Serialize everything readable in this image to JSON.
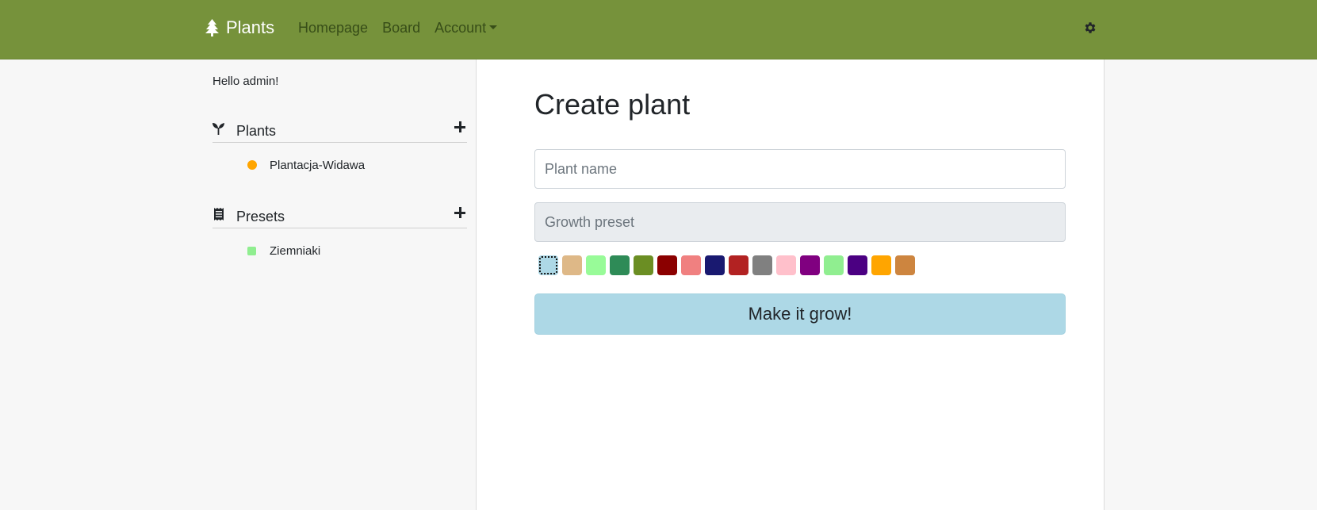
{
  "navbar": {
    "brand": "Plants",
    "links": [
      "Homepage",
      "Board",
      "Account"
    ],
    "settings_icon": "gear-icon"
  },
  "sidebar": {
    "greeting": "Hello admin!",
    "plants": {
      "title": "Plants",
      "icon": "seedling-icon",
      "items": [
        {
          "label": "Plantacja-Widawa",
          "color": "#ffa500"
        }
      ]
    },
    "presets": {
      "title": "Presets",
      "icon": "receipt-icon",
      "items": [
        {
          "label": "Ziemniaki",
          "color": "#90ee90"
        }
      ]
    }
  },
  "form": {
    "title": "Create plant",
    "name_placeholder": "Plant name",
    "preset_placeholder": "Growth preset",
    "selected_color": "#add8e6",
    "colors": [
      "#add8e6",
      "#deb887",
      "#98fb98",
      "#2e8b57",
      "#6b8e23",
      "#8b0000",
      "#f08080",
      "#191970",
      "#b22222",
      "#808080",
      "#ffc0cb",
      "#800080",
      "#90ee90",
      "#4b0082",
      "#ffa500",
      "#cd853f"
    ],
    "submit_label": "Make it grow!"
  }
}
